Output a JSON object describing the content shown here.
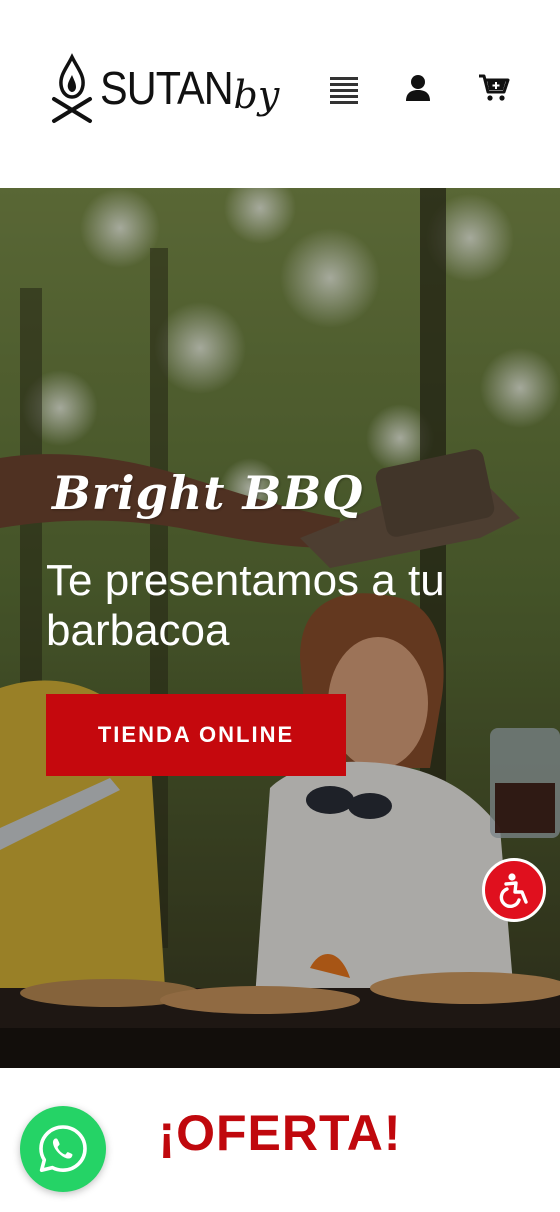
{
  "header": {
    "logo_text": "SUTAN",
    "logo_suffix": "by",
    "menu_icon": "menu-icon",
    "user_icon": "user-icon",
    "cart_icon": "cart-plus-icon"
  },
  "hero": {
    "script_title": "Bright BBQ",
    "heading": "Te presentamos a tu barbacoa",
    "cta_label": "TIENDA ONLINE"
  },
  "offer": {
    "title": "¡OFERTA!"
  },
  "floating": {
    "accessibility_icon": "accessibility-icon",
    "whatsapp_icon": "whatsapp-icon"
  },
  "colors": {
    "brand_red": "#c5080d",
    "whatsapp_green": "#25d366",
    "accessibility_red": "#e0101e"
  }
}
